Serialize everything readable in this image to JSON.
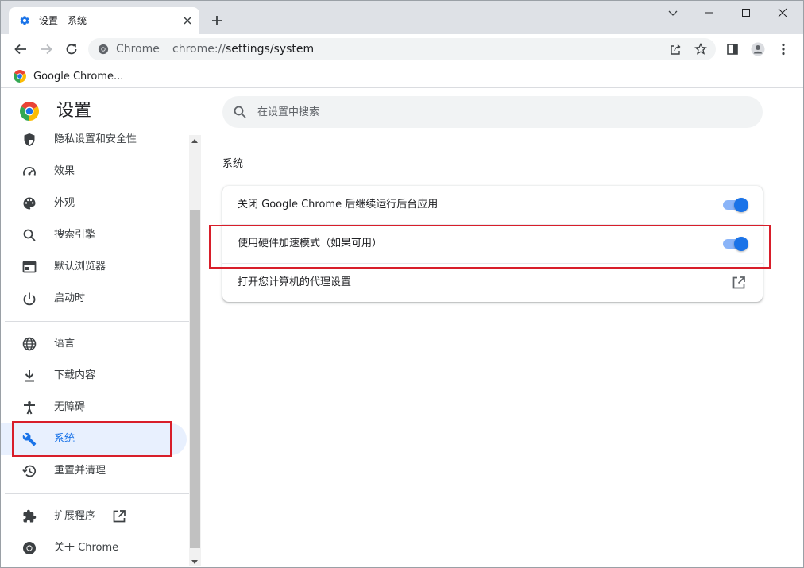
{
  "window": {
    "tab_title": "设置 - 系统",
    "new_tab_label": "+"
  },
  "toolbar": {
    "omnibox_site_label": "Chrome",
    "url_scheme": "chrome://",
    "url_path": "settings/system"
  },
  "bookmarks": [
    {
      "label": "Google Chrome..."
    }
  ],
  "settings": {
    "title": "设置",
    "search_placeholder": "在设置中搜索",
    "sidebar": [
      {
        "id": "privacy",
        "label": "隐私设置和安全性",
        "icon": "shield-icon"
      },
      {
        "id": "performance",
        "label": "效果",
        "icon": "speedometer-icon"
      },
      {
        "id": "appearance",
        "label": "外观",
        "icon": "palette-icon"
      },
      {
        "id": "search-engine",
        "label": "搜索引擎",
        "icon": "search-icon"
      },
      {
        "id": "default-browser",
        "label": "默认浏览器",
        "icon": "browser-window-icon"
      },
      {
        "id": "on-startup",
        "label": "启动时",
        "icon": "power-icon"
      },
      {
        "id": "languages",
        "label": "语言",
        "icon": "globe-icon"
      },
      {
        "id": "downloads",
        "label": "下载内容",
        "icon": "download-icon"
      },
      {
        "id": "accessibility",
        "label": "无障碍",
        "icon": "accessibility-icon"
      },
      {
        "id": "system",
        "label": "系统",
        "icon": "wrench-icon",
        "active": true
      },
      {
        "id": "reset",
        "label": "重置并清理",
        "icon": "history-icon"
      },
      {
        "id": "extensions",
        "label": "扩展程序",
        "icon": "puzzle-icon"
      },
      {
        "id": "about",
        "label": "关于 Chrome",
        "icon": "chrome-icon"
      }
    ],
    "section_title": "系统",
    "rows": [
      {
        "label": "关闭 Google Chrome 后继续运行后台应用",
        "type": "toggle",
        "on": true
      },
      {
        "label": "使用硬件加速模式（如果可用）",
        "type": "toggle",
        "on": true
      },
      {
        "label": "打开您计算机的代理设置",
        "type": "link"
      }
    ]
  },
  "colors": {
    "accent": "#1a73e8",
    "toggle_track": "#8ab4f8",
    "highlight_box": "#d81e2a",
    "tab_strip": "#dee1e6"
  }
}
